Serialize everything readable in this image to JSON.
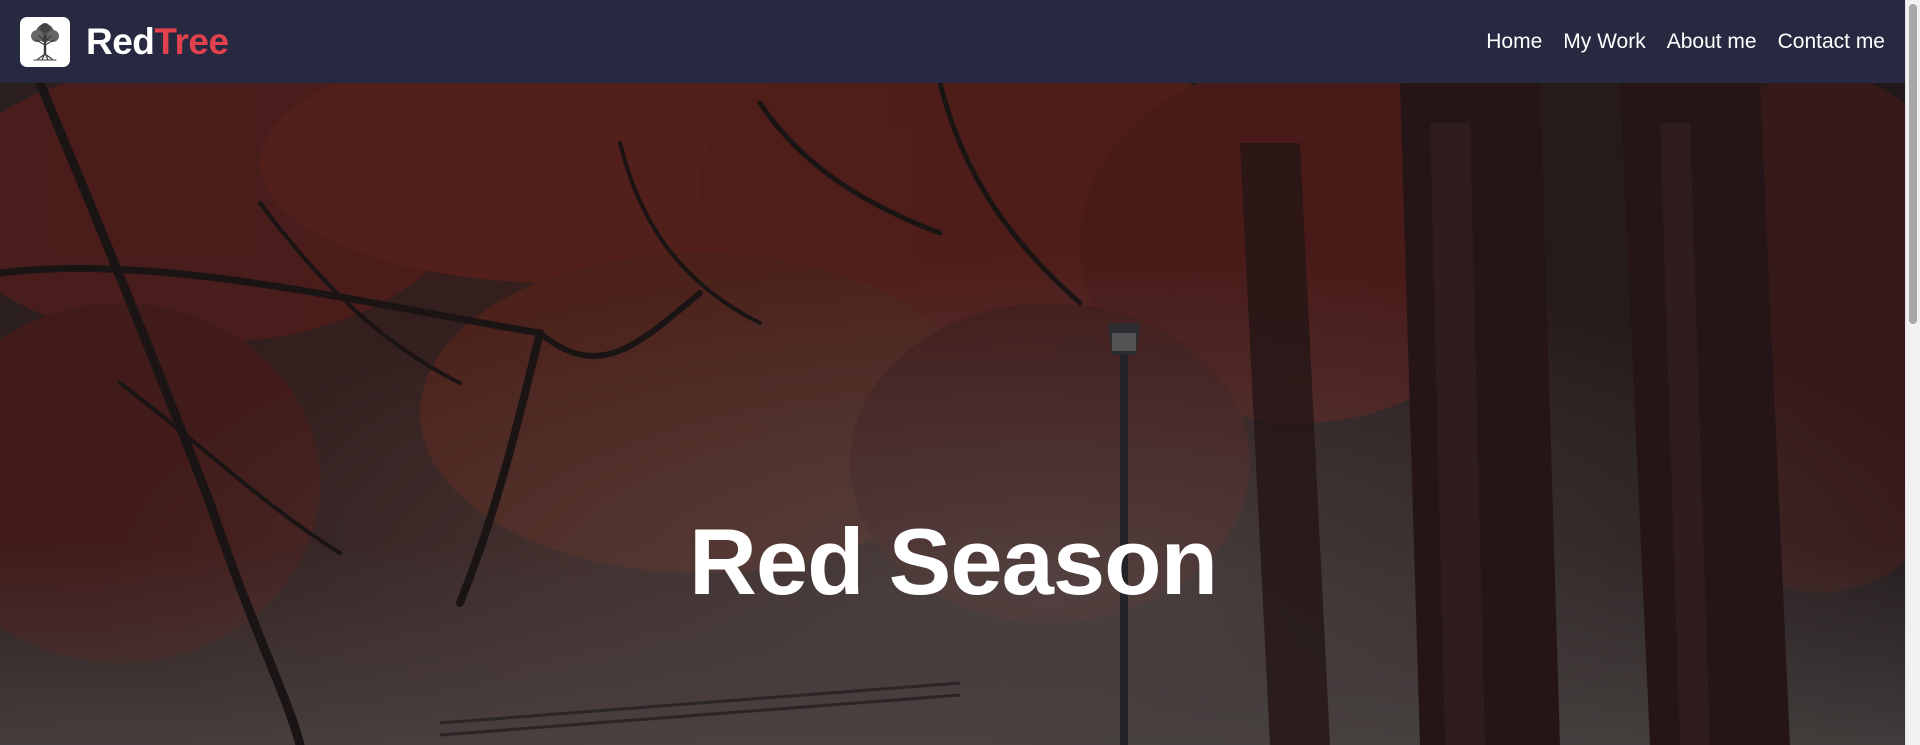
{
  "header": {
    "brand_part1": "Red",
    "brand_part2": "Tree",
    "logo_icon": "tree-icon",
    "background_color": "#262940",
    "accent_color": "#e0414d"
  },
  "nav": {
    "items": [
      {
        "label": "Home"
      },
      {
        "label": "My Work"
      },
      {
        "label": "About me"
      },
      {
        "label": "Contact me"
      }
    ]
  },
  "hero": {
    "title": "Red Season",
    "background": "autumn-red-trees-photo"
  }
}
